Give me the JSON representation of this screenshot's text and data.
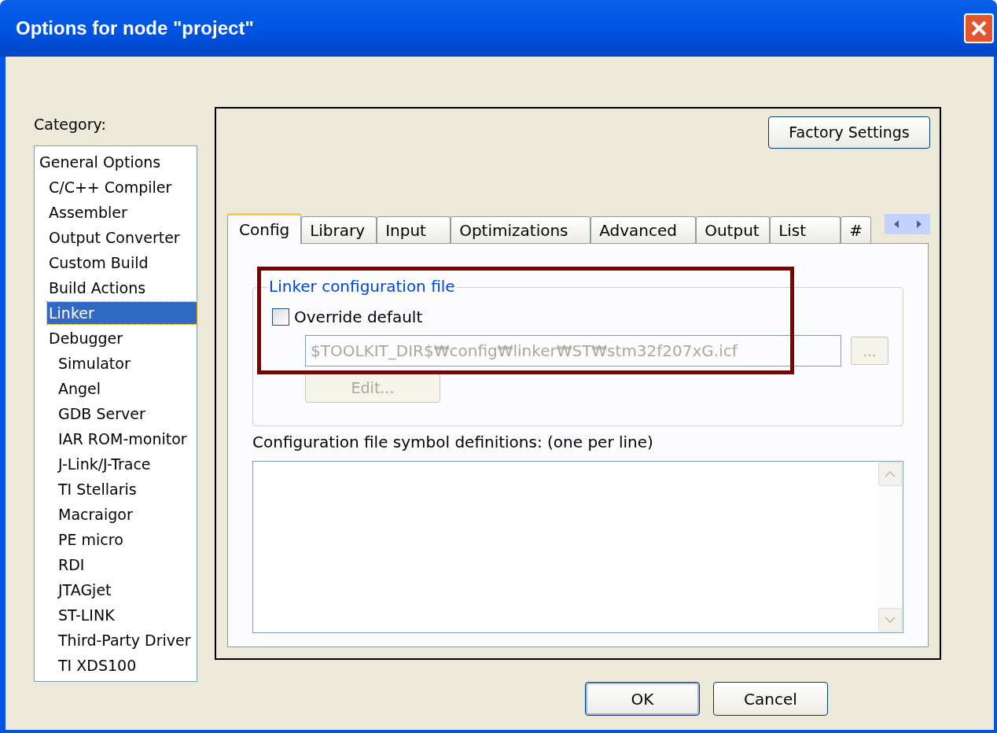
{
  "window": {
    "title": "Options for node \"project\""
  },
  "category": {
    "label": "Category:",
    "items": [
      {
        "label": "General Options",
        "selected": false,
        "children": [
          {
            "label": "C/C++ Compiler",
            "selected": false
          },
          {
            "label": "Assembler",
            "selected": false
          },
          {
            "label": "Output Converter",
            "selected": false
          },
          {
            "label": "Custom Build",
            "selected": false
          },
          {
            "label": "Build Actions",
            "selected": false
          },
          {
            "label": "Linker",
            "selected": true
          },
          {
            "label": "Debugger",
            "selected": false,
            "children": [
              {
                "label": "Simulator",
                "selected": false
              },
              {
                "label": "Angel",
                "selected": false
              },
              {
                "label": "GDB Server",
                "selected": false
              },
              {
                "label": "IAR ROM-monitor",
                "selected": false
              },
              {
                "label": "J-Link/J-Trace",
                "selected": false
              },
              {
                "label": "TI Stellaris",
                "selected": false
              },
              {
                "label": "Macraigor",
                "selected": false
              },
              {
                "label": "PE micro",
                "selected": false
              },
              {
                "label": "RDI",
                "selected": false
              },
              {
                "label": "JTAGjet",
                "selected": false
              },
              {
                "label": "ST-LINK",
                "selected": false
              },
              {
                "label": "Third-Party Driver",
                "selected": false
              },
              {
                "label": "TI XDS100",
                "selected": false
              }
            ]
          }
        ]
      }
    ]
  },
  "factory_settings_button": "Factory Settings",
  "tabs": [
    {
      "label": "Config",
      "selected": true
    },
    {
      "label": "Library",
      "selected": false
    },
    {
      "label": "Input",
      "selected": false
    },
    {
      "label": "Optimizations",
      "selected": false
    },
    {
      "label": "Advanced",
      "selected": false
    },
    {
      "label": "Output",
      "selected": false
    },
    {
      "label": "List",
      "selected": false
    },
    {
      "label": "#",
      "selected": false
    }
  ],
  "linker_config": {
    "title": "Linker configuration file",
    "highlighted": true,
    "override": {
      "label": "Override default",
      "checked": false
    },
    "path": {
      "value": "$TOOLKIT_DIR$₩config₩linker₩ST₩stm32f207xG.icf",
      "disabled": true
    },
    "browse_button": {
      "label": "...",
      "disabled": true
    },
    "edit_button": {
      "label": "Edit...",
      "disabled": true
    }
  },
  "symbol_definitions": {
    "label": "Configuration file symbol definitions: (one per line)"
  },
  "buttons": [
    {
      "label": "OK",
      "default": true
    },
    {
      "label": "Cancel",
      "default": false
    }
  ]
}
